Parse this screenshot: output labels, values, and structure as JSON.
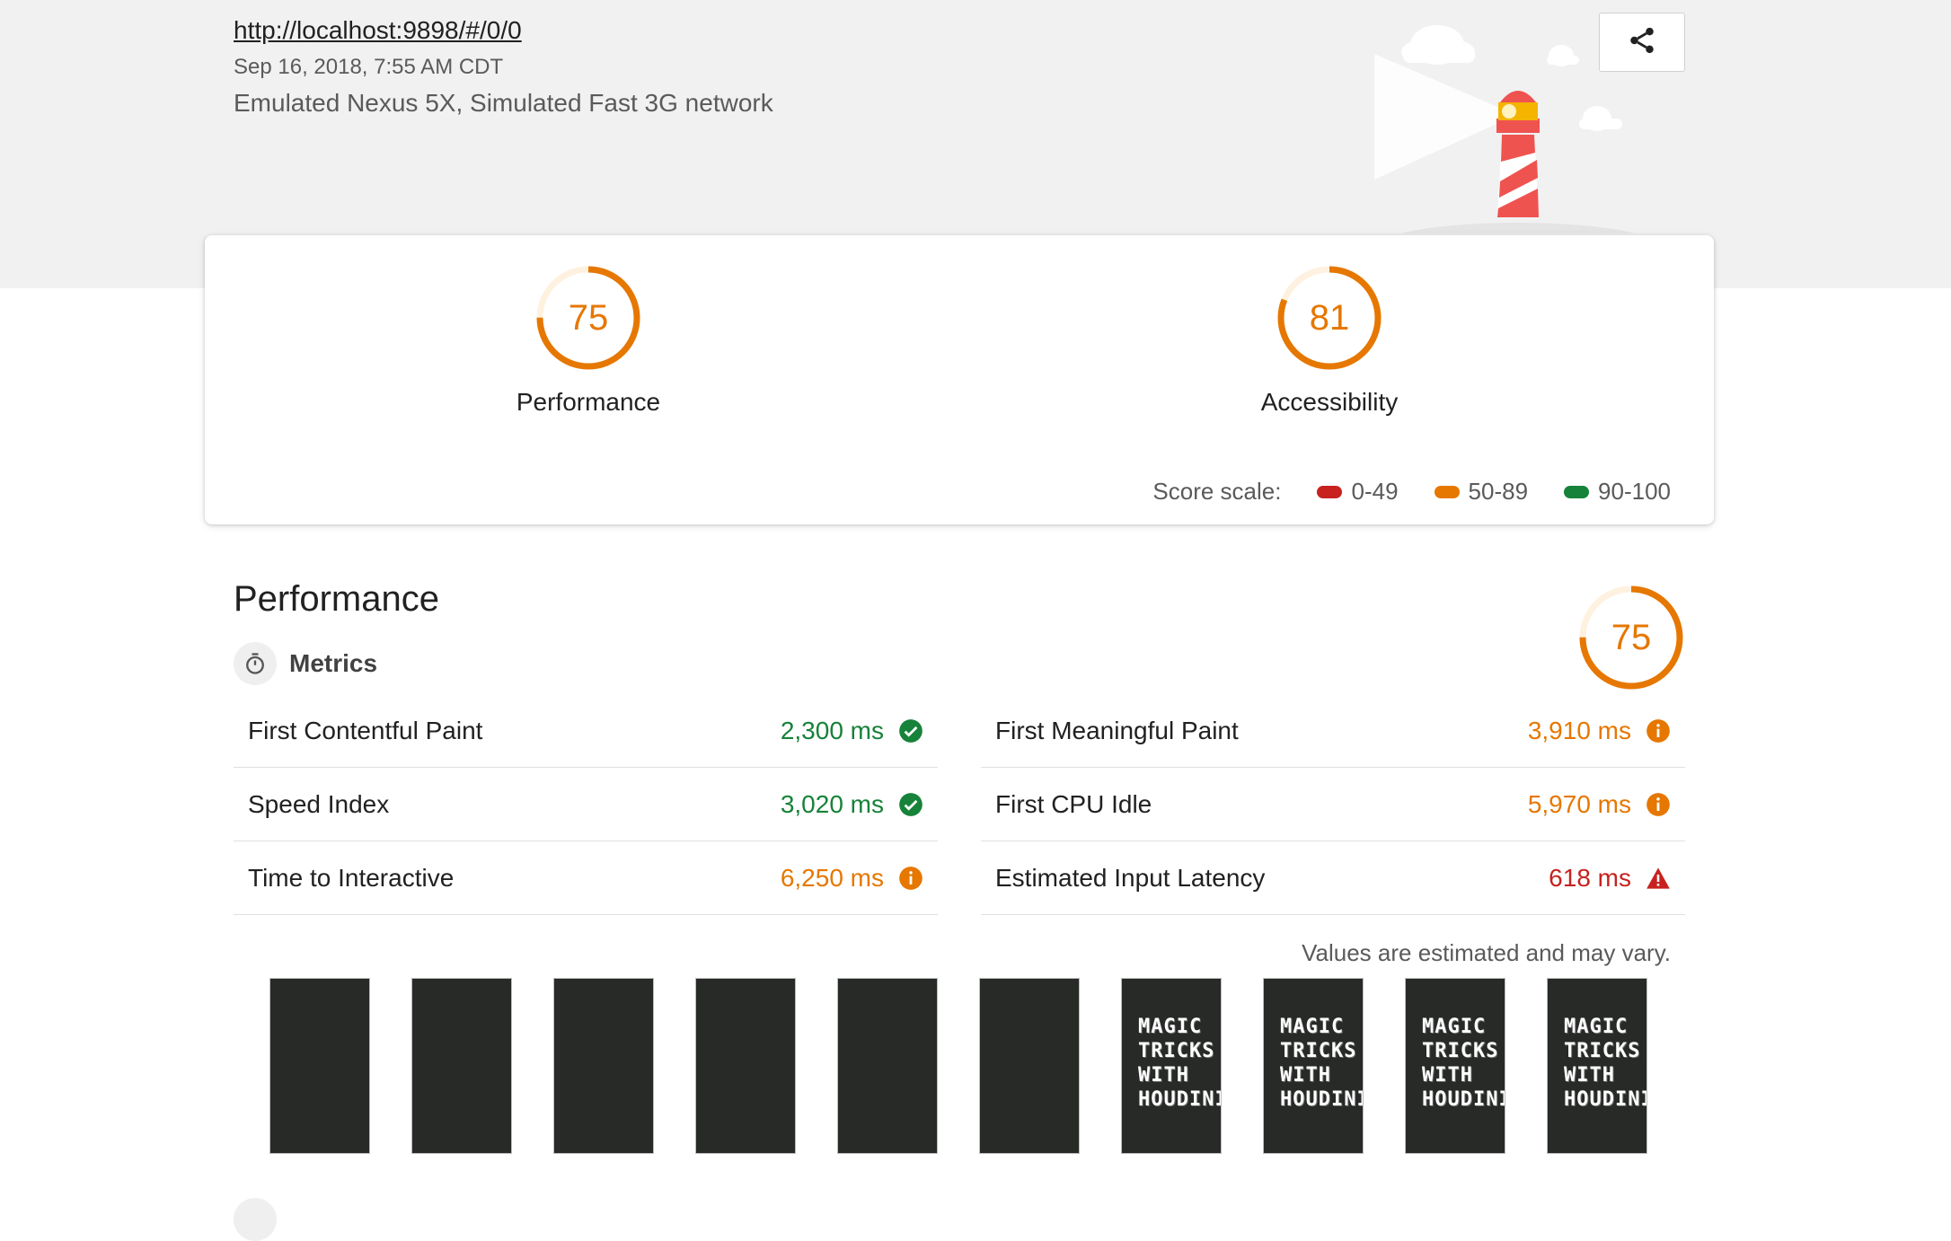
{
  "header": {
    "url": "http://localhost:9898/#/0/0",
    "date": "Sep 16, 2018, 7:55 AM CDT",
    "environment": "Emulated Nexus 5X, Simulated Fast 3G network",
    "share_icon": "share-icon",
    "illustration": "lighthouse-illustration"
  },
  "summary": {
    "gauges": [
      {
        "label": "Performance",
        "score": "75",
        "fraction": 0.75,
        "color": "#e67700"
      },
      {
        "label": "Accessibility",
        "score": "81",
        "fraction": 0.81,
        "color": "#e67700"
      }
    ],
    "scale": {
      "label": "Score scale:",
      "ranges": [
        {
          "label": "0-49",
          "color": "#c7221f"
        },
        {
          "label": "50-89",
          "color": "#e67700"
        },
        {
          "label": "90-100",
          "color": "#178239"
        }
      ]
    }
  },
  "performance": {
    "title": "Performance",
    "score": "75",
    "fraction": 0.75,
    "metrics_label": "Metrics",
    "metrics_left": [
      {
        "name": "First Contentful Paint",
        "value": "2,300 ms",
        "status": "pass"
      },
      {
        "name": "Speed Index",
        "value": "3,020 ms",
        "status": "pass"
      },
      {
        "name": "Time to Interactive",
        "value": "6,250 ms",
        "status": "average"
      }
    ],
    "metrics_right": [
      {
        "name": "First Meaningful Paint",
        "value": "3,910 ms",
        "status": "average"
      },
      {
        "name": "First CPU Idle",
        "value": "5,970 ms",
        "status": "average"
      },
      {
        "name": "Estimated Input Latency",
        "value": "618 ms",
        "status": "fail"
      }
    ],
    "disclaimer": "Values are estimated and may vary.",
    "filmstrip": [
      {
        "text": ""
      },
      {
        "text": ""
      },
      {
        "text": ""
      },
      {
        "text": ""
      },
      {
        "text": ""
      },
      {
        "text": ""
      },
      {
        "text": "MAGIC\nTRICKS\nWITH\nHOUDINI"
      },
      {
        "text": "MAGIC\nTRICKS\nWITH\nHOUDINI"
      },
      {
        "text": "MAGIC\nTRICKS\nWITH\nHOUDINI"
      },
      {
        "text": "MAGIC\nTRICKS\nWITH\nHOUDINI"
      }
    ]
  },
  "colors": {
    "pass": "#178239",
    "average": "#e67700",
    "fail": "#c7221f"
  }
}
